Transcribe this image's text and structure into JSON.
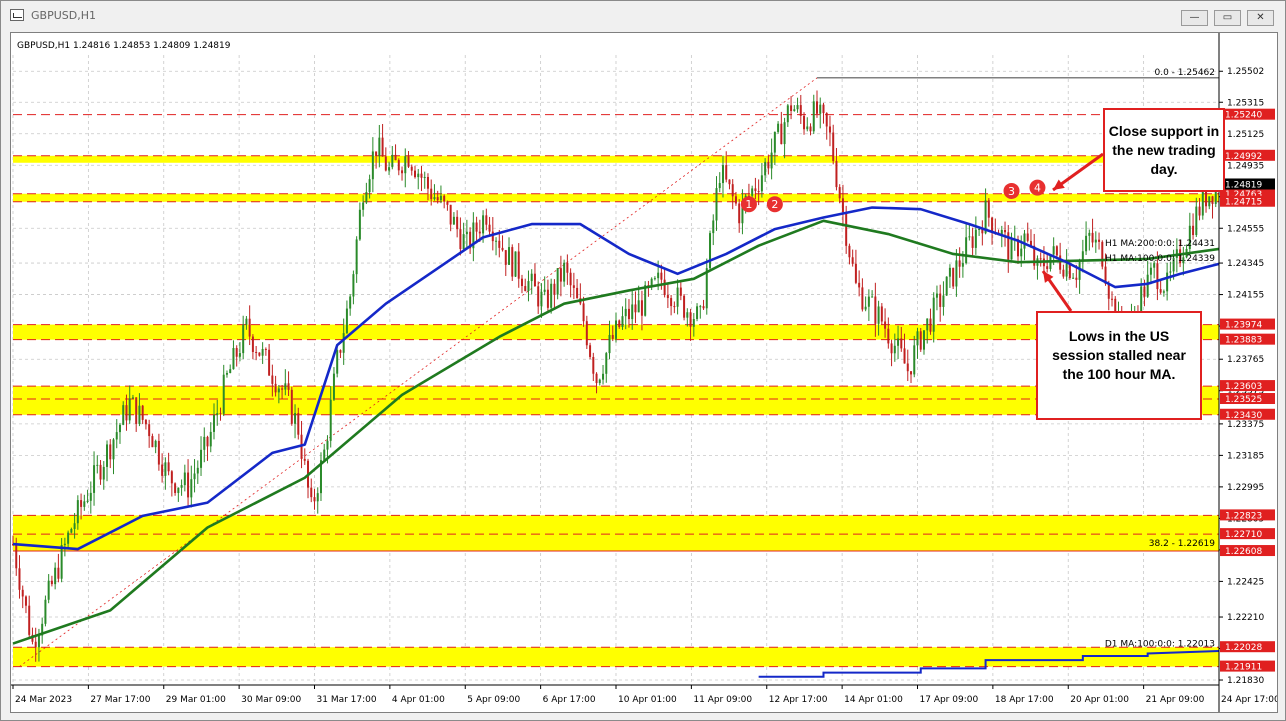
{
  "window": {
    "title": "GBPUSD,H1",
    "minimize": "—",
    "restore": "▭",
    "close": "✕"
  },
  "header": {
    "symbol_line": "GBPUSD,H1  1.24816 1.24853 1.24809 1.24819"
  },
  "colors": {
    "bull": "#2a8a2a",
    "bear": "#c02020",
    "ma100": "#1428c8",
    "ma200": "#1f7a1f",
    "zone": "#ffff00",
    "level": "#e02020",
    "price_box": "#000000",
    "level_box": "#e02020"
  },
  "chart_data": {
    "type": "candlestick",
    "symbol": "GBPUSD",
    "timeframe": "H1",
    "ohlc_last": {
      "open": 1.24816,
      "high": 1.24853,
      "low": 1.24809,
      "close": 1.24819
    },
    "ylim": [
      1.218,
      1.256
    ],
    "y_ticks": [
      "1.25502",
      "1.25315",
      "1.25125",
      "1.24935",
      "1.24745",
      "1.24555",
      "1.24345",
      "1.24155",
      "1.23965",
      "1.23765",
      "1.23575",
      "1.23375",
      "1.23185",
      "1.22995",
      "1.22805",
      "1.22615",
      "1.22425",
      "1.22210",
      "1.22020",
      "1.21830"
    ],
    "x_ticks": [
      "24 Mar 2023",
      "27 Mar 17:00",
      "29 Mar 01:00",
      "30 Mar 09:00",
      "31 Mar 17:00",
      "4 Apr 01:00",
      "5 Apr 09:00",
      "6 Apr 17:00",
      "10 Apr 01:00",
      "11 Apr 09:00",
      "12 Apr 17:00",
      "14 Apr 01:00",
      "17 Apr 09:00",
      "18 Apr 17:00",
      "20 Apr 01:00",
      "21 Apr 09:00",
      "24 Apr 17:00"
    ],
    "close_path": [
      [
        0,
        1.2265
      ],
      [
        6,
        1.2205
      ],
      [
        12,
        1.224
      ],
      [
        18,
        1.2275
      ],
      [
        24,
        1.23
      ],
      [
        30,
        1.2325
      ],
      [
        36,
        1.235
      ],
      [
        42,
        1.2335
      ],
      [
        48,
        1.2305
      ],
      [
        54,
        1.23
      ],
      [
        60,
        1.2325
      ],
      [
        66,
        1.2365
      ],
      [
        72,
        1.2395
      ],
      [
        78,
        1.2375
      ],
      [
        84,
        1.2355
      ],
      [
        88,
        1.2335
      ],
      [
        92,
        1.2285
      ],
      [
        96,
        1.232
      ],
      [
        100,
        1.2375
      ],
      [
        104,
        1.2415
      ],
      [
        108,
        1.248
      ],
      [
        112,
        1.2505
      ],
      [
        116,
        1.249
      ],
      [
        122,
        1.25
      ],
      [
        128,
        1.248
      ],
      [
        134,
        1.2465
      ],
      [
        140,
        1.2445
      ],
      [
        146,
        1.2465
      ],
      [
        152,
        1.244
      ],
      [
        158,
        1.2425
      ],
      [
        164,
        1.241
      ],
      [
        170,
        1.243
      ],
      [
        176,
        1.24
      ],
      [
        180,
        1.2365
      ],
      [
        184,
        1.2385
      ],
      [
        188,
        1.24
      ],
      [
        194,
        1.241
      ],
      [
        200,
        1.2425
      ],
      [
        206,
        1.241
      ],
      [
        212,
        1.24
      ],
      [
        218,
        1.249
      ],
      [
        224,
        1.2465
      ],
      [
        230,
        1.2485
      ],
      [
        236,
        1.251
      ],
      [
        240,
        1.253
      ],
      [
        244,
        1.252
      ],
      [
        248,
        1.2525
      ],
      [
        252,
        1.251
      ],
      [
        256,
        1.2465
      ],
      [
        260,
        1.242
      ],
      [
        264,
        1.241
      ],
      [
        268,
        1.24
      ],
      [
        272,
        1.2385
      ],
      [
        276,
        1.237
      ],
      [
        280,
        1.239
      ],
      [
        284,
        1.2405
      ],
      [
        288,
        1.242
      ],
      [
        292,
        1.2435
      ],
      [
        296,
        1.245
      ],
      [
        300,
        1.2465
      ],
      [
        304,
        1.2455
      ],
      [
        308,
        1.244
      ],
      [
        312,
        1.245
      ],
      [
        316,
        1.243
      ],
      [
        320,
        1.244
      ],
      [
        324,
        1.2435
      ],
      [
        328,
        1.243
      ],
      [
        332,
        1.245
      ],
      [
        336,
        1.244
      ],
      [
        340,
        1.24
      ],
      [
        344,
        1.239
      ],
      [
        348,
        1.2415
      ],
      [
        352,
        1.243
      ],
      [
        356,
        1.242
      ],
      [
        360,
        1.244
      ],
      [
        364,
        1.246
      ],
      [
        368,
        1.2475
      ],
      [
        372,
        1.2482
      ]
    ],
    "ma100_path": [
      [
        0,
        1.2265
      ],
      [
        20,
        1.2262
      ],
      [
        40,
        1.2282
      ],
      [
        60,
        1.229
      ],
      [
        80,
        1.232
      ],
      [
        90,
        1.2325
      ],
      [
        100,
        1.2385
      ],
      [
        115,
        1.241
      ],
      [
        130,
        1.243
      ],
      [
        145,
        1.245
      ],
      [
        160,
        1.2458
      ],
      [
        175,
        1.2458
      ],
      [
        190,
        1.244
      ],
      [
        205,
        1.2428
      ],
      [
        220,
        1.244
      ],
      [
        235,
        1.2455
      ],
      [
        250,
        1.2462
      ],
      [
        265,
        1.2468
      ],
      [
        280,
        1.2467
      ],
      [
        295,
        1.2458
      ],
      [
        310,
        1.2448
      ],
      [
        325,
        1.2435
      ],
      [
        340,
        1.242
      ],
      [
        350,
        1.2422
      ],
      [
        360,
        1.2428
      ],
      [
        372,
        1.2434
      ]
    ],
    "ma200_path": [
      [
        0,
        1.2205
      ],
      [
        30,
        1.2225
      ],
      [
        60,
        1.2275
      ],
      [
        90,
        1.2305
      ],
      [
        120,
        1.2355
      ],
      [
        150,
        1.239
      ],
      [
        170,
        1.241
      ],
      [
        190,
        1.2418
      ],
      [
        210,
        1.2425
      ],
      [
        230,
        1.2445
      ],
      [
        250,
        1.246
      ],
      [
        270,
        1.2452
      ],
      [
        290,
        1.244
      ],
      [
        310,
        1.2435
      ],
      [
        330,
        1.2436
      ],
      [
        350,
        1.2437
      ],
      [
        372,
        1.2443
      ]
    ],
    "series": [
      {
        "name": "GBPUSD,H1",
        "values": [
          1.24816,
          1.24853,
          1.24809,
          1.24819
        ]
      },
      {
        "name": "H1 MA:100:0:0",
        "value": 1.24339
      },
      {
        "name": "H1 MA:200:0:0",
        "value": 1.24431
      },
      {
        "name": "D1 MA:100:0:0",
        "value": 1.22013
      }
    ],
    "horizontal_levels": [
      {
        "value": 1.2524,
        "label": "1.25240",
        "style": "dashed"
      },
      {
        "value": 1.24992,
        "label": "1.24992",
        "style": "dashed"
      },
      {
        "value": 1.24763,
        "label": "1.24763",
        "style": "dashed"
      },
      {
        "value": 1.24715,
        "label": "1.24715",
        "style": "dashed"
      },
      {
        "value": 1.23974,
        "label": "1.23974",
        "style": "dashed"
      },
      {
        "value": 1.23883,
        "label": "1.23883",
        "style": "dashed"
      },
      {
        "value": 1.23603,
        "label": "1.23603",
        "style": "dashed"
      },
      {
        "value": 1.23525,
        "label": "1.23525",
        "style": "dashed"
      },
      {
        "value": 1.2343,
        "label": "1.23430",
        "style": "dashed"
      },
      {
        "value": 1.22823,
        "label": "1.22823",
        "style": "dashed"
      },
      {
        "value": 1.2271,
        "label": "1.22710",
        "style": "dashed"
      },
      {
        "value": 1.22608,
        "label": "1.22608",
        "style": "solid"
      },
      {
        "value": 1.22028,
        "label": "1.22028",
        "style": "dashed"
      },
      {
        "value": 1.21911,
        "label": "1.21911",
        "style": "dashed"
      }
    ],
    "zones": [
      [
        1.24715,
        1.24763
      ],
      [
        1.2495,
        1.24992
      ],
      [
        1.23883,
        1.23974
      ],
      [
        1.2343,
        1.23603
      ],
      [
        1.22608,
        1.22823
      ],
      [
        1.21911,
        1.22028
      ]
    ],
    "fib_labels": [
      {
        "label": "0.0 - 1.25462",
        "value": 1.25462
      },
      {
        "label": "38.2 - 1.22619",
        "value": 1.22619
      }
    ],
    "ma_labels": [
      {
        "label": "H1 MA:200:0:0: 1.24431",
        "value": 1.24431,
        "series": "ma200"
      },
      {
        "label": "H1 MA:100:0:0: 1.24339",
        "value": 1.24339,
        "series": "ma100"
      },
      {
        "label": "D1 MA:100:0:0: 1.22013",
        "value": 1.22013,
        "series": "d1"
      }
    ],
    "current_price": {
      "label": "1.24819",
      "value": 1.24819
    },
    "markers": [
      {
        "text": "1",
        "x": 227,
        "value": 1.247
      },
      {
        "text": "2",
        "x": 235,
        "value": 1.247
      },
      {
        "text": "3",
        "x": 308,
        "value": 1.2478
      },
      {
        "text": "4",
        "x": 316,
        "value": 1.248
      }
    ],
    "annotations": [
      {
        "text": "Close support in the new trading day."
      },
      {
        "text": "Lows in the US session stalled near the 100 hour MA."
      }
    ]
  }
}
